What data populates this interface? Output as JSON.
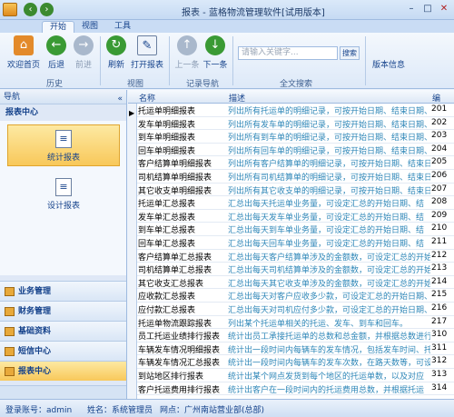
{
  "title": "报表 - 蓝格物流管理软件[试用版本]",
  "tabs": [
    "开始",
    "视图",
    "工具"
  ],
  "ribbon": {
    "buttons": {
      "home": "欢迎首页",
      "back": "后退",
      "forward": "前进",
      "refresh": "刷新",
      "open_report": "打开报表",
      "prev": "上一条",
      "next": "下一条",
      "version": "版本信息"
    },
    "search_placeholder": "请输入关键字...",
    "search_button": "搜索",
    "groups": [
      "历史",
      "视图",
      "记录导航",
      "全文搜索"
    ]
  },
  "nav": {
    "header": "导航",
    "title": "报表中心",
    "big_items": [
      "统计报表",
      "设计报表"
    ],
    "sections": [
      "业务管理",
      "财务管理",
      "基础资料",
      "短信中心",
      "报表中心"
    ]
  },
  "grid": {
    "columns": [
      "名称",
      "描述",
      "编"
    ],
    "rows": [
      {
        "name": "托运单明细报表",
        "desc": "列出所有托运单的明细记录，可按开始日期、结束日期、",
        "code": "201"
      },
      {
        "name": "发车单明细报表",
        "desc": "列出所有发车单的明细记录，可按开始日期、结束日期、",
        "code": "202"
      },
      {
        "name": "到车单明细报表",
        "desc": "列出所有到车单的明细记录，可按开始日期、结束日期、",
        "code": "203"
      },
      {
        "name": "回车单明细报表",
        "desc": "列出所有回车单的明细记录，可按开始日期、结束日期、",
        "code": "204"
      },
      {
        "name": "客户结算单明细报表",
        "desc": "列出所有客户结算单的明细记录，可按开始日期、结束日",
        "code": "205"
      },
      {
        "name": "司机结算单明细报表",
        "desc": "列出所有司机结算单的明细记录，可按开始日期、结束日",
        "code": "206"
      },
      {
        "name": "其它收支单明细报表",
        "desc": "列出所有其它收支单的明细记录，可按开始日期、结束日",
        "code": "207"
      },
      {
        "name": "托运单汇总报表",
        "desc": "汇总出每天托运单业务量，可设定汇总的开始日期、结",
        "code": "208"
      },
      {
        "name": "发车单汇总报表",
        "desc": "汇总出每天发车单业务量，可设定汇总的开始日期、结",
        "code": "209"
      },
      {
        "name": "到车单汇总报表",
        "desc": "汇总出每天到车单业务量，可设定汇总的开始日期、结",
        "code": "210"
      },
      {
        "name": "回车单汇总报表",
        "desc": "汇总出每天回车单业务量，可设定汇总的开始日期、结",
        "code": "211"
      },
      {
        "name": "客户结算单汇总报表",
        "desc": "汇总出每天客户结算单涉及的金额数，可设定汇总的开始",
        "code": "212"
      },
      {
        "name": "司机结算单汇总报表",
        "desc": "汇总出每天司机结算单涉及的金额数，可设定汇总的开始",
        "code": "213"
      },
      {
        "name": "其它收支汇总报表",
        "desc": "汇总出每天其它收支单涉及的金额数，可设定汇总的开始",
        "code": "214"
      },
      {
        "name": "应收款汇总报表",
        "desc": "汇总出每天对客户应收多少款，可设定汇总的开始日期、",
        "code": "215"
      },
      {
        "name": "应付款汇总报表",
        "desc": "汇总出每天对司机应付多少款，可设定汇总的开始日期、",
        "code": "216"
      },
      {
        "name": "托运单物流跟踪报表",
        "desc": "列出某个托运单相关的托运、发车、到车和回车。",
        "code": "217"
      },
      {
        "name": "员工托运业绩排行报表",
        "desc": "统计出员工承接托运单的总数和总金额，并根据总数进行",
        "code": "310"
      },
      {
        "name": "车辆发车情况明细报表",
        "desc": "统计出一段时间内每辆车的发车情况，包括发车时间、托",
        "code": "311"
      },
      {
        "name": "车辆发车情况汇总报表",
        "desc": "统计出一段时间内每辆车的发车次数，在路天数等，可设",
        "code": "312"
      },
      {
        "name": "到站地区排行报表",
        "desc": "统计出某个网点发货到每个地区的托运单数，以及对应",
        "code": "313"
      },
      {
        "name": "客户托运费用排行报表",
        "desc": "统计出客户在一段时间内的托运费用总数，并根据托运",
        "code": "314"
      }
    ]
  },
  "status": {
    "account": "登录账号：admin",
    "name": "姓名：系统管理员",
    "site": "网点：广州南站营业部(总部)"
  },
  "colors": {
    "accent": "#15428b",
    "selected": "#f8c85a",
    "desc_text": "#2f87b8"
  }
}
